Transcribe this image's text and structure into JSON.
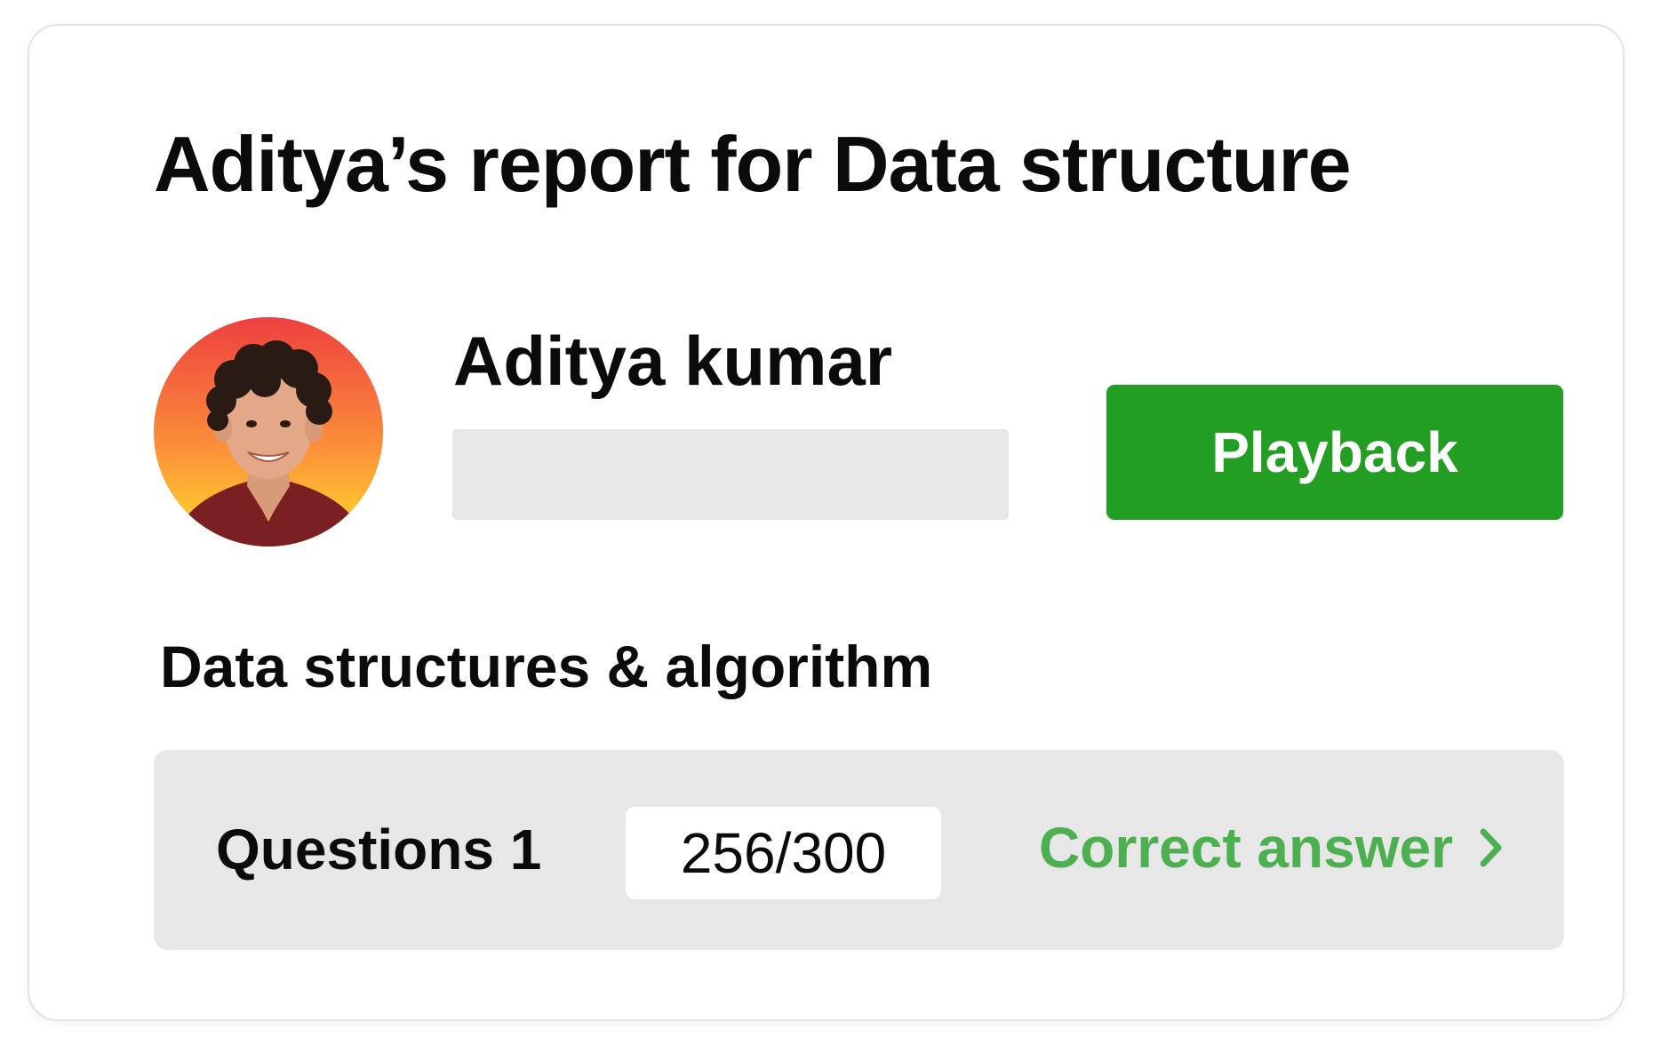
{
  "report": {
    "title": "Aditya’s report for Data structure"
  },
  "user": {
    "name": "Aditya kumar",
    "avatar_icon": "avatar-photo"
  },
  "actions": {
    "playback_label": "Playback"
  },
  "section": {
    "title": "Data structures & algorithm"
  },
  "questions": [
    {
      "label": "Questions 1",
      "score": "256/300",
      "link_label": "Correct answer",
      "link_icon": "chevron-right-icon"
    }
  ],
  "colors": {
    "accent": "#229e22",
    "link": "#4caf50",
    "placeholder": "#e7e7e7",
    "avatar_gradient_top": "#ee4b3d",
    "avatar_gradient_bottom": "#ffd234"
  }
}
